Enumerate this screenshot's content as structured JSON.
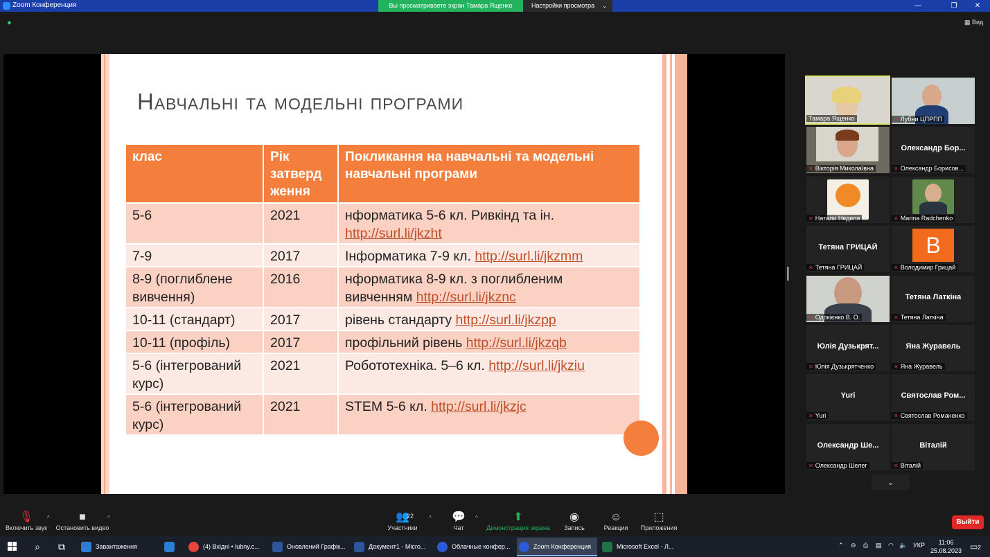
{
  "window": {
    "title": "Zoom Конференция",
    "sharing_banner": "Вы просматриваете экран Тамара Ященко",
    "view_options": "Настройки просмотра",
    "view_label": "Вид",
    "minimize": "—",
    "maximize": "❐",
    "close": "✕"
  },
  "slide": {
    "title": "Навчальні та модельні програми",
    "headers": [
      "клас",
      "Рік затверд ження",
      "Покликання на навчальні та модельні навчальні програми"
    ],
    "rows": [
      {
        "grade": "5-6",
        "year": "2021",
        "text": "нформатика 5-6 кл. Ривкінд та ін. ",
        "link": "http://surl.li/jkzht"
      },
      {
        "grade": "7-9",
        "year": "2017",
        "text": "Інформатика 7-9 кл. ",
        "link": "http://surl.li/jkzmm"
      },
      {
        "grade": "8-9 (поглиблене вивчення)",
        "year": "2016",
        "text": "нформатика 8-9 кл. з поглибленим вивченням ",
        "link": "http://surl.li/jkznc"
      },
      {
        "grade": "10-11 (стандарт)",
        "year": "2017",
        "text": "рівень стандарту ",
        "link": "http://surl.li/jkzpp"
      },
      {
        "grade": "10-11 (профіль)",
        "year": "2017",
        "text": "профільний рівень ",
        "link": "http://surl.li/jkzqb"
      },
      {
        "grade": "5-6 (інтегрований курс)",
        "year": "2021",
        "text": "Робототехніка. 5–6 кл. ",
        "link": "http://surl.li/jkziu"
      },
      {
        "grade": "5-6 (інтегрований курс)",
        "year": "2021",
        "text": "STEM 5-6 кл. ",
        "link": "http://surl.li/jkzjc"
      }
    ]
  },
  "participants": {
    "tiles": [
      {
        "label": "Тамара Ященко",
        "display": "",
        "muted": false,
        "kind": "photo"
      },
      {
        "label": "Лубни ЦПРПП",
        "display": "",
        "muted": true,
        "kind": "photo"
      },
      {
        "label": "Вікторія Миколаївна",
        "display": "",
        "muted": true,
        "kind": "photo"
      },
      {
        "label": "Олександр Борисов...",
        "display": "Олександр  Бор...",
        "muted": true,
        "kind": "name"
      },
      {
        "label": "Натали Неделя",
        "display": "",
        "muted": true,
        "kind": "photo"
      },
      {
        "label": "Marina Radchenko",
        "display": "",
        "muted": true,
        "kind": "photo"
      },
      {
        "label": "Тетяна ГРИЦАЙ",
        "display": "Тетяна ГРИЦАЙ",
        "muted": true,
        "kind": "name"
      },
      {
        "label": "Володимир Грицай",
        "display": "",
        "muted": true,
        "kind": "avatar",
        "avatar_letter": "В"
      },
      {
        "label": "Одокієнко В. О.",
        "display": "",
        "muted": true,
        "kind": "photo"
      },
      {
        "label": "Тетяна Латкіна",
        "display": "Тетяна Латкіна",
        "muted": true,
        "kind": "name"
      },
      {
        "label": "Юлія Дузькрятченко",
        "display": "Юлія  Дузькрят...",
        "muted": true,
        "kind": "name"
      },
      {
        "label": "Яна Журавель",
        "display": "Яна Журавель",
        "muted": true,
        "kind": "name"
      },
      {
        "label": "Yuri",
        "display": "Yuri",
        "muted": true,
        "kind": "name"
      },
      {
        "label": "Святослав Романенко",
        "display": "Святослав  Ром...",
        "muted": true,
        "kind": "name"
      },
      {
        "label": "Олександр Шелег",
        "display": "Олександр  Ше...",
        "muted": true,
        "kind": "name"
      },
      {
        "label": "Віталій",
        "display": "Віталій",
        "muted": true,
        "kind": "name"
      }
    ]
  },
  "toolbar": {
    "unmute": "Включить звук",
    "stop_video": "Остановить видео",
    "participants": "Участники",
    "participants_count": "22",
    "chat": "Чат",
    "share_screen": "Демонстрация экрана",
    "record": "Запись",
    "reactions": "Реакции",
    "apps": "Приложения",
    "leave": "Выйти"
  },
  "taskbar": {
    "apps": [
      {
        "label": "Завантаження",
        "color": "#2d7dd2"
      },
      {
        "label": "",
        "color": "#2d7dd2"
      },
      {
        "label": "(4) Вхідні • lubny.c...",
        "color": "#e8453c"
      },
      {
        "label": "Оновлений Графік...",
        "color": "#2b579a"
      },
      {
        "label": "Документ1 - Micro...",
        "color": "#2b579a"
      },
      {
        "label": "Облачные конфер...",
        "color": "#2d5bd8"
      },
      {
        "label": "Zoom Конференция",
        "color": "#2d5bd8"
      },
      {
        "label": "Microsoft Excel - Л...",
        "color": "#217346"
      }
    ],
    "language": "УКР",
    "time": "11:06",
    "date": "25.08.2023",
    "notifications": "2"
  }
}
